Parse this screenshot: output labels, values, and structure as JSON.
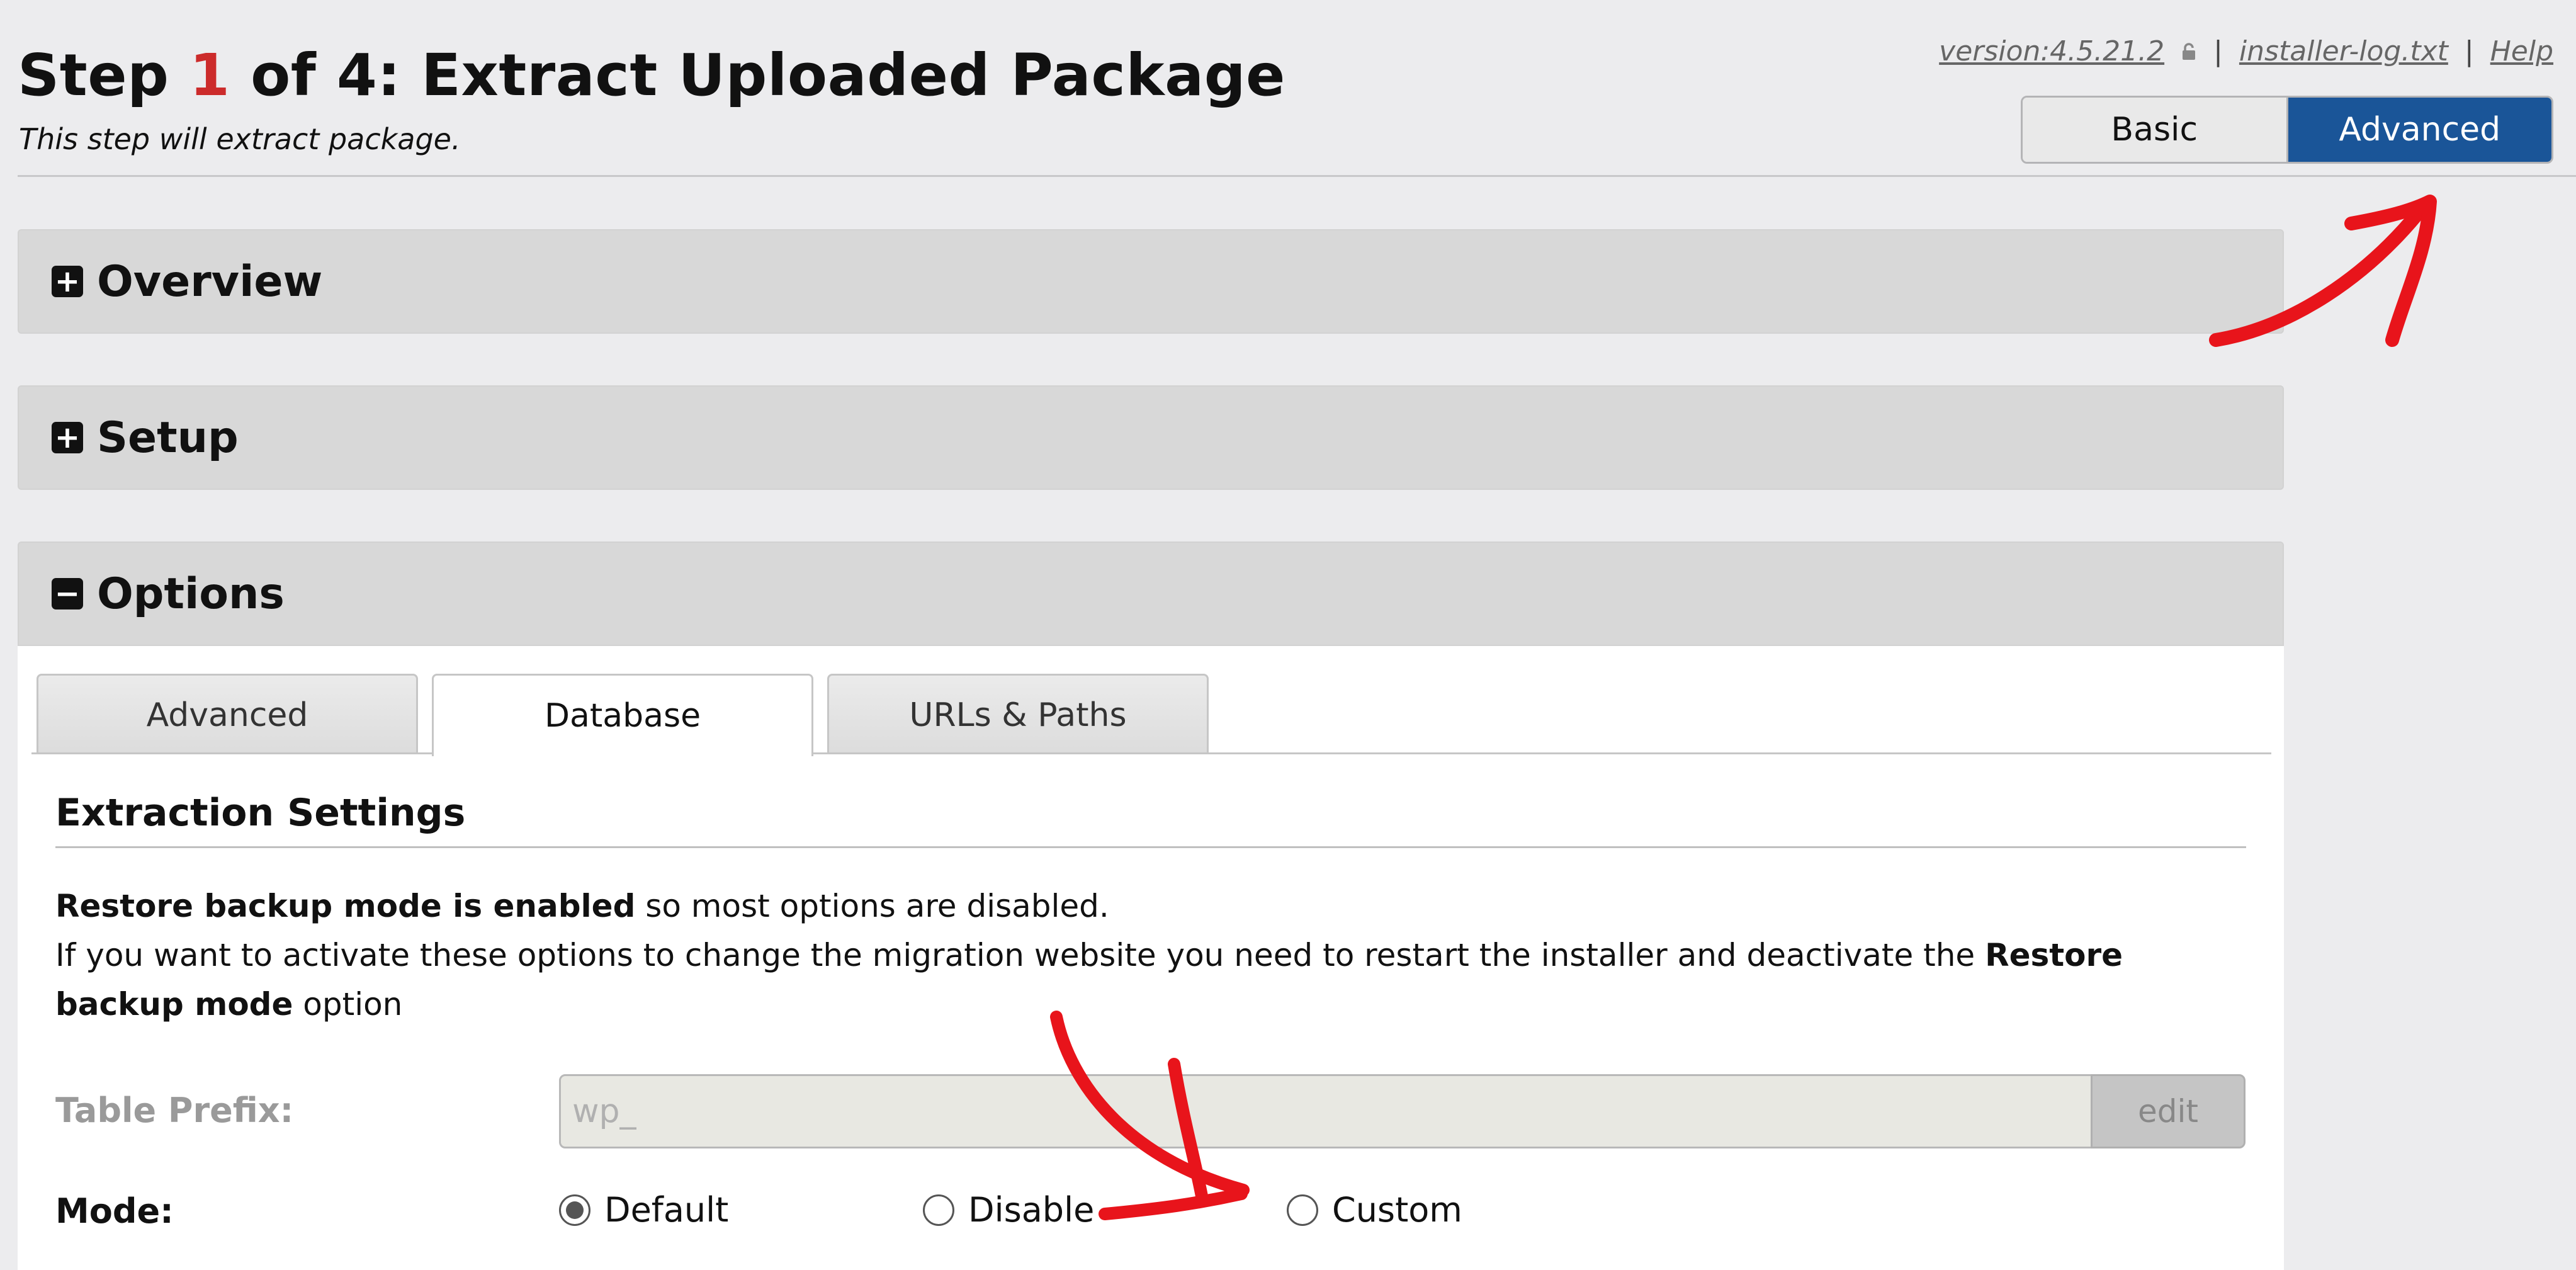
{
  "header": {
    "title_prefix": "Step ",
    "step_number": "1",
    "title_suffix": " of 4: Extract Uploaded Package",
    "subtitle": "This step will extract package."
  },
  "toplinks": {
    "version": "version:4.5.21.2",
    "separator": "|",
    "log": "installer-log.txt",
    "help": "Help"
  },
  "mode_toggle": {
    "basic": "Basic",
    "advanced": "Advanced",
    "selected": "Advanced"
  },
  "panels": {
    "overview": {
      "icon": "+",
      "title": "Overview"
    },
    "setup": {
      "icon": "+",
      "title": "Setup"
    },
    "options": {
      "icon": "−",
      "title": "Options"
    }
  },
  "tabs": {
    "advanced": "Advanced",
    "database": "Database",
    "urls": "URLs & Paths",
    "active": "Database"
  },
  "section": {
    "title": "Extraction Settings",
    "notice_bold_1": "Restore backup mode is enabled",
    "notice_text_1": " so most options are disabled.",
    "notice_text_2": "If you want to activate these options to change the migration website you need to restart the installer and deactivate the ",
    "notice_bold_2": "Restore backup mode",
    "notice_text_3": " option"
  },
  "fields": {
    "table_prefix_label": "Table Prefix:",
    "table_prefix_value": "wp_",
    "edit_label": "edit",
    "mode_label": "Mode:",
    "mode_options": [
      "Default",
      "Disable",
      "Custom"
    ],
    "mode_selected": "Default"
  },
  "colors": {
    "accent": "#1a5598",
    "step_number": "#cc2b2b",
    "annotation": "#e8141b"
  },
  "icons": {
    "lock": "lock-icon",
    "expand": "plus-square-icon",
    "collapse": "minus-square-icon"
  }
}
